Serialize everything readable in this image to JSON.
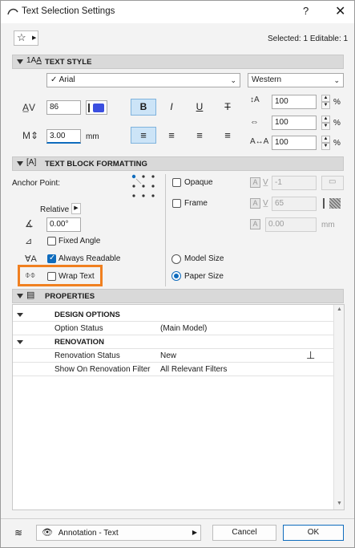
{
  "window": {
    "title": "Text Selection Settings",
    "help": "?",
    "close": "✕"
  },
  "header": {
    "status": "Selected: 1 Editable: 1"
  },
  "text_style": {
    "section_label": "TEXT STYLE",
    "font": "Arial",
    "font_check": "✓",
    "script": "Western",
    "size": "86",
    "pen_size": "3.00",
    "pen_unit": "mm",
    "bold": "B",
    "italic": "I",
    "underline": "U",
    "strike": "T",
    "width_pct": "100",
    "spacing_pct": "100",
    "char_spacing_pct": "100",
    "pct": "%"
  },
  "block": {
    "section_label": "TEXT BLOCK FORMATTING",
    "anchor_label": "Anchor Point:",
    "opaque": "Opaque",
    "frame": "Frame",
    "opaque_pen": "-1",
    "frame_pen": "65",
    "frame_offset": "0.00",
    "frame_unit": "mm",
    "relative": "Relative",
    "angle": "0.00°",
    "fixed_angle": "Fixed Angle",
    "always_readable": "Always Readable",
    "wrap_text": "Wrap Text",
    "model_size": "Model Size",
    "paper_size": "Paper Size"
  },
  "properties": {
    "section_label": "PROPERTIES",
    "rows": [
      {
        "key": "DESIGN OPTIONS",
        "value": ""
      },
      {
        "key": "Option Status",
        "value": "(Main Model)"
      },
      {
        "key": "RENOVATION",
        "value": ""
      },
      {
        "key": "Renovation Status",
        "value": "New"
      },
      {
        "key": "Show On Renovation Filter",
        "value": "All Relevant Filters"
      }
    ]
  },
  "footer": {
    "layer": "Annotation - Text",
    "cancel": "Cancel",
    "ok": "OK"
  },
  "colors": {
    "accent": "#0f6cbd",
    "highlight": "#f08020",
    "pen_swatch": "#3b4fe0"
  }
}
